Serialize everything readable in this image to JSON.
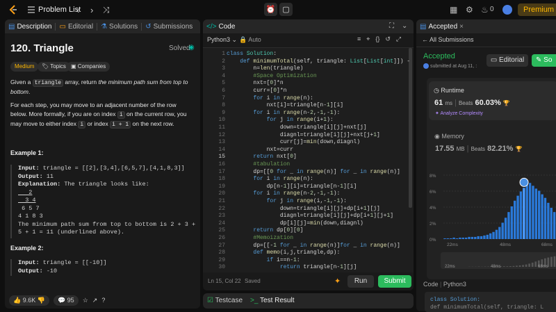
{
  "topbar": {
    "title": "Problem List",
    "premium": "Premium",
    "fire_count": "0"
  },
  "desc": {
    "tabs": [
      "Description",
      "Editorial",
      "Solutions",
      "Submissions"
    ],
    "title": "120. Triangle",
    "solved": "Solved",
    "chips": [
      "Medium",
      "Topics",
      "Companies"
    ],
    "p1a": "Given a ",
    "p1code": "triangle",
    "p1b": " array, return ",
    "p1em": "the minimum path sum from top to bottom",
    ".": ".",
    "p1end": ".",
    "p2a": "For each step, you may move to an adjacent number of the row below. More formally, if you are on index ",
    "p2i": "i",
    "p2b": " on the current row, you may move to either index ",
    "p2i2": "i",
    "p2c": " or index ",
    "p2i3": "i + 1",
    "p2d": " on the next row.",
    "ex1_h": "Example 1:",
    "ex1_input_label": "Input:",
    "ex1_input": " triangle = [[2],[3,4],[6,5,7],[4,1,8,3]]",
    "ex1_output_label": "Output:",
    "ex1_output": " 11",
    "ex1_expl_label": "Explanation:",
    "ex1_expl": " The triangle looks like:",
    "ex1_tri": [
      "   2",
      "  3 4",
      " 6 5 7",
      "4 1 8 3"
    ],
    "ex1_note1": "The minimum path sum from top to bottom is 2 + 3 +",
    "ex1_note2": "5 + 1 = 11 (underlined above).",
    "ex2_h": "Example 2:",
    "ex2_input_label": "Input:",
    "ex2_input": " triangle = [[-10]]",
    "ex2_output_label": "Output:",
    "ex2_output": " -10",
    "likes": "9.6K",
    "comments": "95"
  },
  "code": {
    "tab": "Code",
    "lang": "Python3",
    "auto": "Auto",
    "status": "Ln 15, Col 22",
    "saved": "Saved",
    "run": "Run",
    "submit": "Submit",
    "bottom_tabs": [
      "Testcase",
      "Test Result"
    ],
    "lines": [
      "class Solution:",
      "    def minimumTotal(self, triangle: List[List[int]]) -> int",
      "        n=len(triangle)",
      "        #Space Optimization",
      "        nxt=[0]*n",
      "        curr=[0]*n",
      "        for i in range(n):",
      "            nxt[i]=triangle[n-1][i]",
      "        for i in range(n-2,-1,-1):",
      "            for j in range(i+1):",
      "                down=triangle[i][j]+nxt[j]",
      "                diagnl=triangle[i][j]+nxt[j+1]",
      "                curr[j]=min(down,diagnl)",
      "            nxt=curr",
      "        return nxt[0]",
      "        #tabulation",
      "        dp=[[0 for _ in range(n)] for _ in range(n)]",
      "        for i in range(n):",
      "            dp[n-1][i]=triangle[n-1][i]",
      "        for i in range(n-2,-1,-1):",
      "            for j in range(i,-1,-1):",
      "                down=triangle[i][j]+dp[i+1][j]",
      "                diagnl=triangle[i][j]+dp[i+1][j+1]",
      "                dp[i][j]=min(down,diagnl)",
      "        return dp[0][0]",
      "        #Memoization",
      "        dp=[[-1 for _ in range(n)]for _ in range(n)]",
      "        def memo(i,j,triangle,dp):",
      "            if i==n-1:",
      "                return triangle[n-1][j]"
    ]
  },
  "result": {
    "tab": "Accepted",
    "all": "All Submissions",
    "status": "Accepted",
    "submitted": "submitted at Aug 11, :",
    "editorial": "Editorial",
    "sol": "So",
    "runtime_label": "Runtime",
    "runtime_val": "61",
    "runtime_unit": "ms",
    "beats_label": "Beats",
    "runtime_beats": "60.03%",
    "analyze": "Analyze Complexity",
    "memory_label": "Memory",
    "memory_val": "17.55",
    "memory_unit": "MB",
    "memory_beats": "82.21%",
    "yticks": [
      "8%",
      "6%",
      "4%",
      "2%",
      "0%"
    ],
    "xticks": [
      "22ms",
      "48ms",
      "68ms"
    ],
    "mini_ticks": [
      "22ms",
      "48ms",
      "68ms"
    ],
    "code_label": "Code",
    "code_lang": "Python3",
    "code_preview": "class Solution:",
    "code_preview2": "    def minimumTotal(self, triangle: L"
  },
  "chart_data": {
    "type": "bar",
    "ylabel": "",
    "xlabel": "",
    "ylim": [
      0,
      9
    ],
    "xticks": [
      "22ms",
      "48ms",
      "68ms"
    ],
    "values": [
      0.1,
      0.1,
      0.1,
      0.2,
      0.1,
      0.2,
      0.2,
      0.2,
      0.3,
      0.3,
      0.3,
      0.4,
      0.4,
      0.5,
      0.6,
      0.8,
      1.0,
      1.3,
      1.7,
      2.3,
      3.0,
      3.8,
      4.6,
      5.4,
      6.1,
      6.7,
      7.2,
      7.6,
      7.9,
      7.5,
      7.1,
      6.8,
      6.3,
      5.8,
      5.1,
      4.4,
      3.8
    ]
  }
}
